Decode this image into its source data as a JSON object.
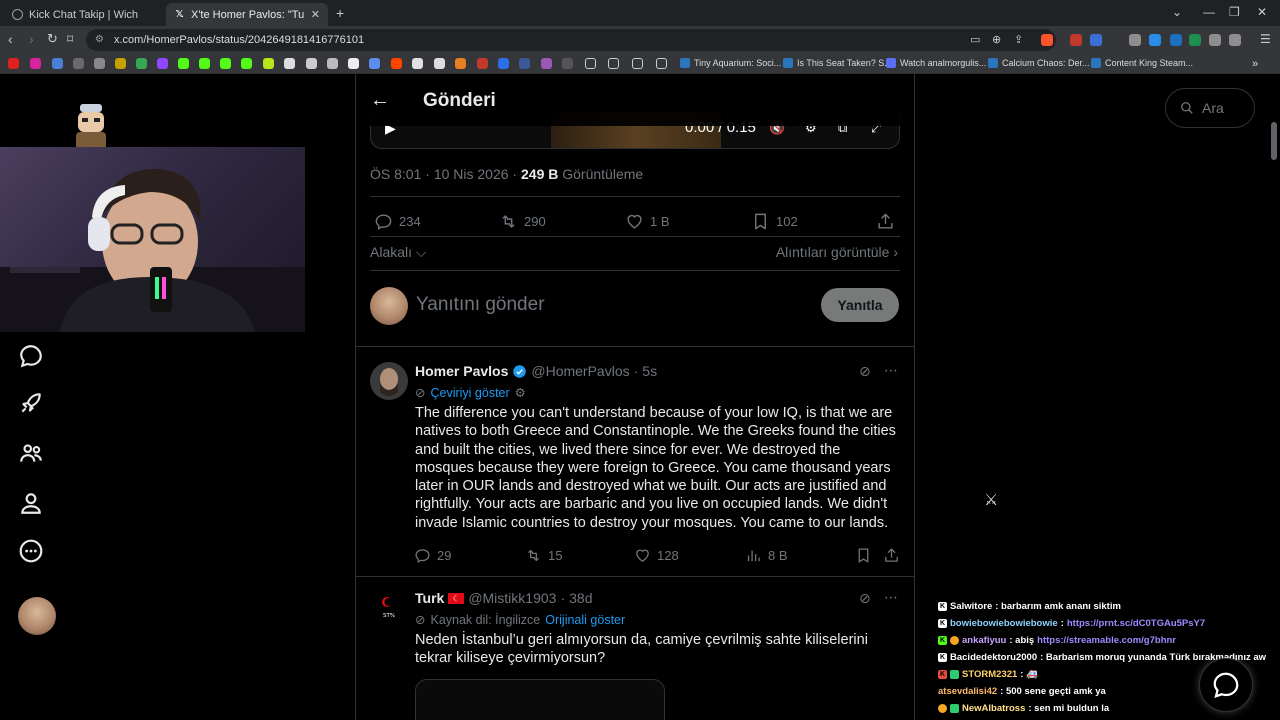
{
  "browser": {
    "tabs": [
      {
        "title": "Kick Chat Takip | Wich",
        "active": false
      },
      {
        "title": "X'te Homer Pavlos: \"Turks conve",
        "active": true
      }
    ],
    "new_tab": "+",
    "url": "x.com/HomerPavlos/status/2042649181416776101",
    "bookmarks": [
      {
        "label": "Tiny Aquarium: Soci..."
      },
      {
        "label": "Is This Seat Taken? S..."
      },
      {
        "label": "Watch analmorgulis..."
      },
      {
        "label": "Calcium Chaos: Der..."
      },
      {
        "label": "Content King Steam..."
      }
    ]
  },
  "x": {
    "header_title": "Gönderi",
    "video": {
      "time": "0:00 / 0:15"
    },
    "meta": {
      "time": "ÖS 8:01",
      "date": "10 Nis 2026",
      "views_count": "249 B",
      "views_label": "Görüntüleme"
    },
    "stats": {
      "replies": "234",
      "reposts": "290",
      "likes": "1 B",
      "bookmarks": "102"
    },
    "related_label": "Alakalı",
    "quotes_label": "Alıntıları görüntüle",
    "reply_placeholder": "Yanıtını gönder",
    "reply_button": "Yanıtla",
    "search_placeholder": "Ara",
    "replies": [
      {
        "name": "Homer Pavlos",
        "handle": "@HomerPavlos",
        "time": "5s",
        "translate_link": "Çeviriyi göster",
        "text": "The difference you can't understand because of your low IQ, is that we are natives to both Greece and Constantinople. We the Greeks found the cities and built the cities, we lived there since for ever. We destroyed the mosques because they were foreign to Greece. You came thousand years later in OUR lands and destroyed what we built. Our acts are justified and rightfully. Your acts are barbaric and you live on occupied lands. We didn't invade Islamic countries to destroy your mosques. You came to our lands.",
        "replies": "29",
        "reposts": "15",
        "likes": "128",
        "views": "8 B"
      },
      {
        "name": "Turk",
        "handle": "@Mistikk1903",
        "time": "38d",
        "source_lang": "Kaynak dil: İngilizce",
        "translate_link": "Orijinali göster",
        "text": "Neden İstanbul’u geri almıyorsun da, camiye çevrilmiş sahte kiliselerini tekrar kiliseye çevirmiyorsun?",
        "avatar_text": "ST%"
      }
    ]
  },
  "chat": {
    "messages": [
      {
        "user": "Salwitore",
        "text": ": barbarım amk ananı siktim",
        "link": "",
        "user_color": "#ffffff"
      },
      {
        "user": "bowiebowiebowiebowie",
        "text": ": ",
        "link": "https://prnt.sc/dC0TGAu5PsY7",
        "user_color": "#8fd3ff"
      },
      {
        "user": "ankafiyuu",
        "text": ": abiş ",
        "link": "https://streamable.com/g7bhnr",
        "user_color": "#c9a0ff"
      },
      {
        "user": "Bacidedektoru2000",
        "text": ": Barbarism moruq yunanda Türk bırakmadınız aw",
        "link": "",
        "user_color": "#ffffff"
      },
      {
        "user": "STORM2321",
        "text": ": 🚑",
        "link": "",
        "user_color": "#ffd36b"
      },
      {
        "user": "atsevdalisi42",
        "text": ": 500 sene geçti amk ya",
        "link": "",
        "user_color": "#ffb86b"
      },
      {
        "user": "NewAlbatross",
        "text": ": sen mi buldun la",
        "link": "",
        "user_color": "#ffe08a"
      }
    ]
  }
}
